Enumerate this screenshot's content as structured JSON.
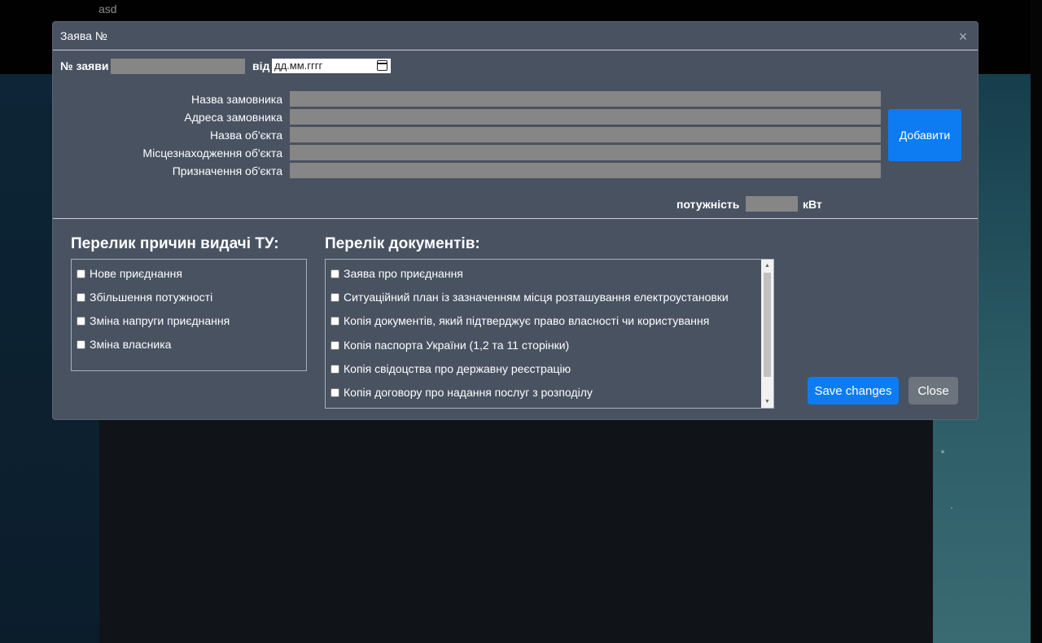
{
  "page": {
    "top_text": "asd"
  },
  "modal": {
    "title": "Заява №",
    "close_icon": "×",
    "number_label": "№ заяви",
    "date_from_label": "від",
    "date_placeholder": "дд.мм.гггг",
    "fields": [
      {
        "label": "Назва замовника"
      },
      {
        "label": "Адреса замовника"
      },
      {
        "label": "Назва об'єкта"
      },
      {
        "label": "Місцезнаходження об'єкта"
      },
      {
        "label": "Призначення об'єкта"
      }
    ],
    "add_button": "Добавити",
    "power_label": "потужність",
    "power_unit": "кВт",
    "reasons": {
      "title": "Перелик причин видачі ТУ:",
      "items": [
        "Нове приєднання",
        "Збільшення потужності",
        "Зміна напруги приєднання",
        "Зміна власника"
      ]
    },
    "documents": {
      "title": "Перелік документів:",
      "items": [
        "Заява про приєднання",
        "Ситуаційний план із зазначенням місця розташування електроустановки",
        "Копія документів, який підтверджує право власності чи користування",
        "Копія паспорта України (1,2 та 11 сторінки)",
        "Копія свідоцства про державну реєстрацію",
        "Копія договору про надання послуг з розподілу"
      ]
    },
    "save_button": "Save changes",
    "close_button": "Close"
  },
  "colors": {
    "modal_bg": "#495261",
    "primary": "#0d7cf2",
    "secondary": "#6c757d",
    "input_gray": "#868686"
  }
}
